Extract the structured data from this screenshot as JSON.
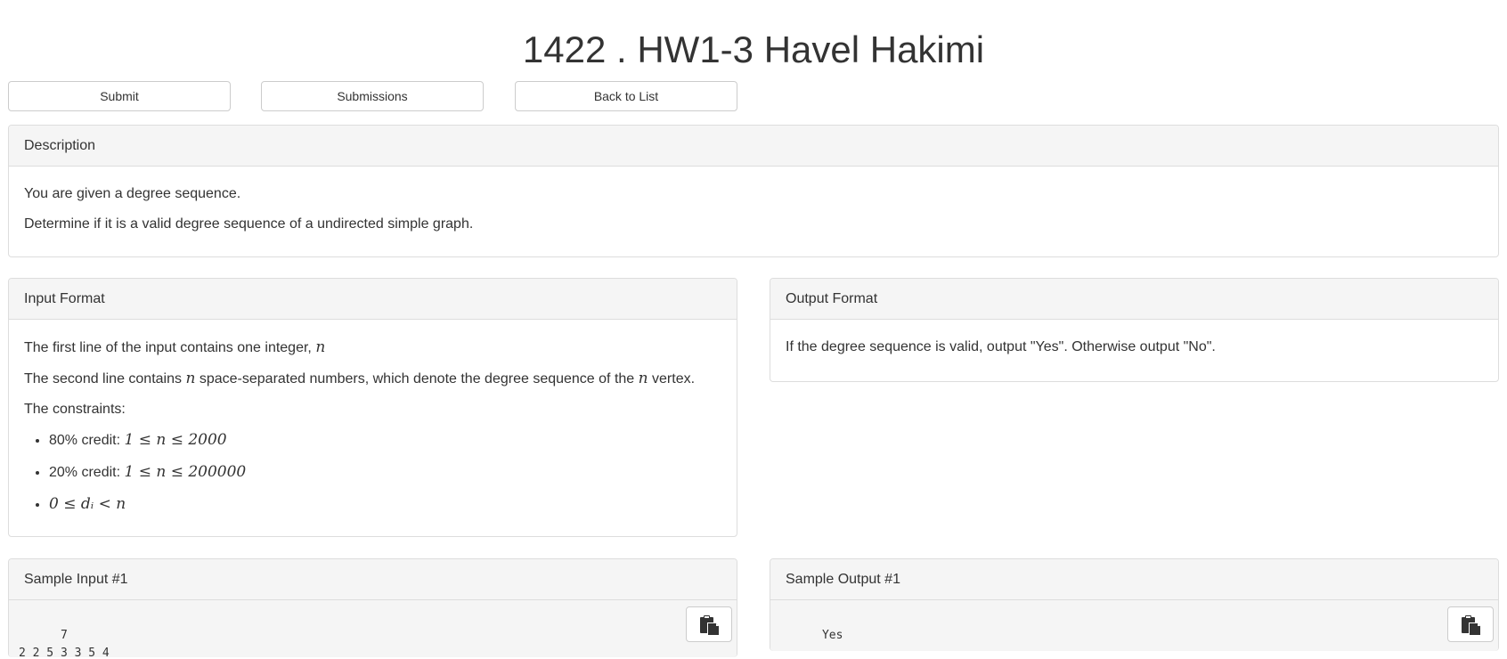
{
  "header": {
    "title": "1422 . HW1-3 Havel Hakimi"
  },
  "toolbar": {
    "submit_label": "Submit",
    "submissions_label": "Submissions",
    "back_label": "Back to List"
  },
  "description": {
    "heading": "Description",
    "lines": [
      "You are given a degree sequence.",
      "Determine if it is a valid degree sequence of a undirected simple graph."
    ]
  },
  "input_format": {
    "heading": "Input Format",
    "line1_text": "The first line of the input contains one integer, ",
    "line1_var": "n",
    "line2_pre": "The second line contains ",
    "line2_var1": "n",
    "line2_mid": " space-separated numbers, which denote the degree sequence of the ",
    "line2_var2": "n",
    "line2_post": " vertex.",
    "constraints_label": "The constraints:",
    "constraints": [
      {
        "prefix": "80% credit: ",
        "math": "1 ≤ n ≤ 2000"
      },
      {
        "prefix": "20% credit: ",
        "math": "1 ≤ n ≤ 200000"
      },
      {
        "prefix": "",
        "math": "0 ≤ dᵢ < n"
      }
    ]
  },
  "output_format": {
    "heading": "Output Format",
    "text": "If the degree sequence is valid, output \"Yes\". Otherwise output \"No\"."
  },
  "sample_input": {
    "heading": "Sample Input #1",
    "content": "7\n2 2 5 3 3 5 4"
  },
  "sample_output": {
    "heading": "Sample Output #1",
    "content": "Yes"
  },
  "icons": {
    "copy": "clipboard-icon"
  }
}
